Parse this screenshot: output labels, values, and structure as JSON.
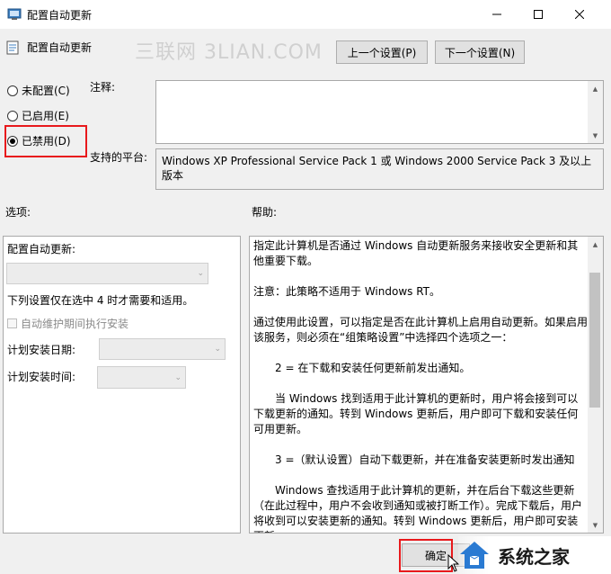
{
  "window": {
    "title": "配置自动更新",
    "icon": "policy-icon",
    "controls": [
      "minimize-icon",
      "maximize-icon",
      "close-icon"
    ]
  },
  "header": {
    "policy_name": "配置自动更新",
    "watermark": "三联网 3LIAN.COM",
    "prev_label": "上一个设置(P)",
    "next_label": "下一个设置(N)"
  },
  "state": {
    "not_configured": "未配置(C)",
    "enabled": "已启用(E)",
    "disabled": "已禁用(D)",
    "selected": "disabled",
    "highlight_color": "#e8191c"
  },
  "comment": {
    "label": "注释:",
    "value": ""
  },
  "platform": {
    "label": "支持的平台:",
    "value": "Windows XP Professional Service Pack 1 或 Windows 2000 Service Pack 3 及以上版本"
  },
  "options": {
    "label": "选项:",
    "configure_label": "配置自动更新:",
    "configure_value": "",
    "note": "下列设置仅在选中 4 时才需要和适用。",
    "auto_maintenance": "自动维护期间执行安装",
    "day_label": "计划安装日期:",
    "day_value": "",
    "time_label": "计划安装时间:",
    "time_value": ""
  },
  "help": {
    "label": "帮助:",
    "paragraphs": [
      "指定此计算机是否通过 Windows 自动更新服务来接收安全更新和其他重要下载。",
      "注意：此策略不适用于 Windows RT。",
      "通过使用此设置，可以指定是否在此计算机上启用自动更新。如果启用该服务，则必须在“组策略设置”中选择四个选项之一：",
      "2 = 在下载和安装任何更新前发出通知。",
      "当 Windows 找到适用于此计算机的更新时，用户将会接到可以下载更新的通知。转到 Windows 更新后，用户即可下载和安装任何可用更新。",
      "3 =（默认设置）自动下载更新，并在准备安装更新时发出通知",
      "Windows 查找适用于此计算机的更新，并在后台下载这些更新（在此过程中，用户不会收到通知或被打断工作）。完成下载后，用户将收到可以安装更新的通知。转到 Windows 更新后，用户即可安装更新。"
    ]
  },
  "footer": {
    "ok_label": "确定",
    "logo_text": "系统之家"
  }
}
